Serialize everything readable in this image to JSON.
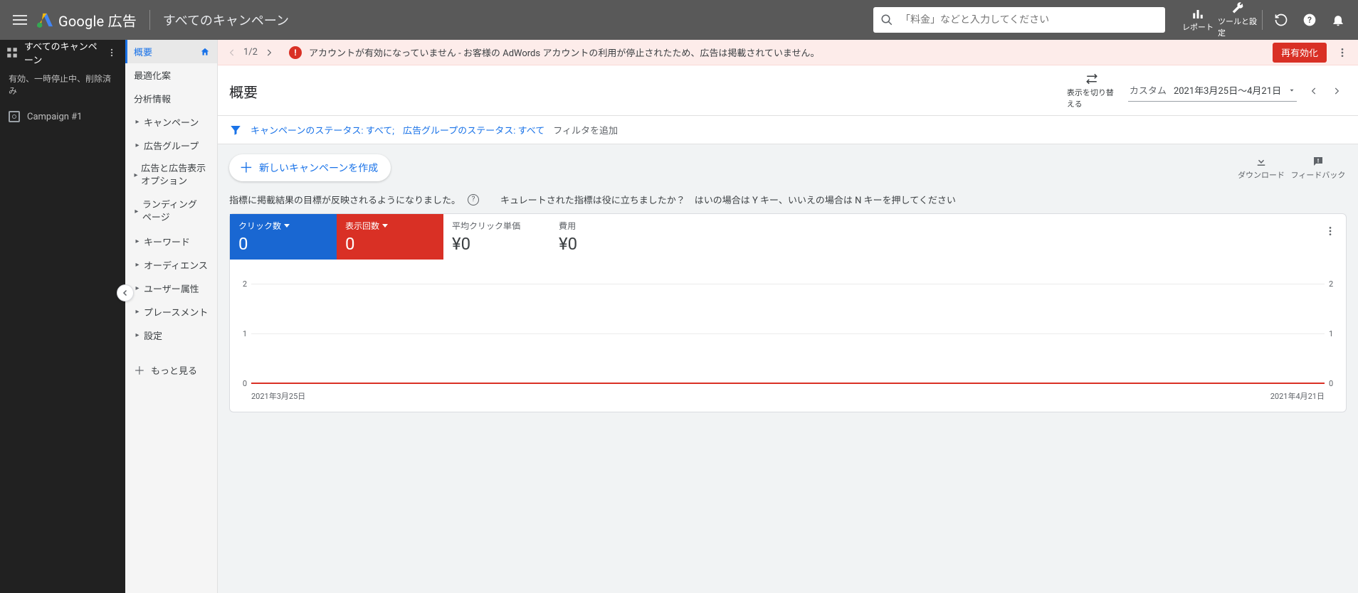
{
  "header": {
    "product": "Google 広告",
    "scope_title": "すべてのキャンペーン",
    "search_placeholder": "「料金」などと入力してください",
    "tool_reports": "レポート",
    "tool_settings": "ツールと設定"
  },
  "left": {
    "scope": "すべてのキャンペーン",
    "status_filter": "有効、一時停止中、削除済み",
    "campaign": "Campaign #1"
  },
  "nav": {
    "overview": "概要",
    "recommendations": "最適化案",
    "insights": "分析情報",
    "campaigns": "キャンペーン",
    "adgroups": "広告グループ",
    "ads_ext": "広告と広告表示オプション",
    "landing": "ランディング ページ",
    "keywords": "キーワード",
    "audiences": "オーディエンス",
    "demographics": "ユーザー属性",
    "placements": "プレースメント",
    "settings": "設定",
    "more": "もっと見る"
  },
  "banner": {
    "page": "1/2",
    "message": "アカウントが有効になっていません - お客様の AdWords アカウントの利用が停止されたため、広告は掲載されていません。",
    "reactivate": "再有効化"
  },
  "title": {
    "heading": "概要",
    "view_toggle": "表示を切り替える",
    "date_label": "カスタム",
    "date_range": "2021年3月25日～4月21日"
  },
  "filter": {
    "campaign_status": "キャンペーンのステータス: すべて;",
    "adgroup_status": "広告グループのステータス: すべて",
    "add": "フィルタを追加"
  },
  "actions": {
    "new_campaign": "新しいキャンペーンを作成",
    "download": "ダウンロード",
    "feedback": "フィードバック"
  },
  "hints": {
    "left": "指標に掲載結果の目標が反映されるようになりました。",
    "right": "キュレートされた指標は役に立ちましたか？　はいの場合は Y キー、いいえの場合は N キーを押してください"
  },
  "metrics": {
    "clicks_label": "クリック数",
    "clicks_value": "0",
    "impressions_label": "表示回数",
    "impressions_value": "0",
    "cpc_label": "平均クリック単価",
    "cpc_value": "¥0",
    "cost_label": "費用",
    "cost_value": "¥0"
  },
  "chart_data": {
    "type": "line",
    "x_start": "2021年3月25日",
    "x_end": "2021年4月21日",
    "series": [
      {
        "name": "クリック数",
        "color": "#1967d2",
        "values_all_zero": true
      },
      {
        "name": "表示回数",
        "color": "#d93025",
        "values_all_zero": true
      }
    ],
    "y_ticks_left": [
      0,
      1,
      2
    ],
    "y_ticks_right": [
      0,
      1,
      2
    ],
    "ylim": [
      0,
      2
    ]
  }
}
